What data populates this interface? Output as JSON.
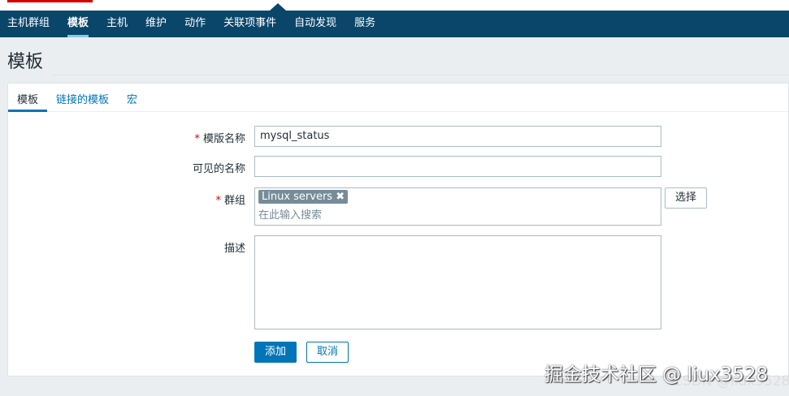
{
  "nav": [
    "主机群组",
    "模板",
    "主机",
    "维护",
    "动作",
    "关联项事件",
    "自动发现",
    "服务"
  ],
  "page_title": "模板",
  "tabs": [
    "模板",
    "链接的模板",
    "宏"
  ],
  "form": {
    "name_label": "模版名称",
    "name_value": "mysql_status",
    "visible_label": "可见的名称",
    "visible_value": "",
    "group_label": "群组",
    "group_tag": "Linux servers",
    "group_placeholder": "在此输入搜索",
    "select_button": "选择",
    "desc_label": "描述",
    "desc_value": "",
    "add_button": "添加",
    "cancel_button": "取消"
  },
  "watermark": "掘金技术社区 @ liux3528",
  "watermark2": "CSDN @liux3528"
}
